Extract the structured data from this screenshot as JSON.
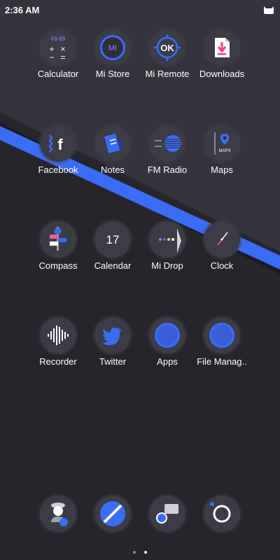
{
  "status_bar": {
    "time": "2:36 AM",
    "right_icon": "cat-icon"
  },
  "colors": {
    "accent": "#3b6cf6",
    "background_dark": "#25252b",
    "background_light": "#33333b",
    "icon_bg": "#3b3c46"
  },
  "apps": [
    {
      "label": "Calculator",
      "icon": "calculator-icon",
      "display": "69-69"
    },
    {
      "label": "Mi Store",
      "icon": "mi-store-icon",
      "badge": "MI"
    },
    {
      "label": "Mi Remote",
      "icon": "mi-remote-icon",
      "badge": "OK"
    },
    {
      "label": "Downloads",
      "icon": "downloads-icon"
    },
    {
      "label": "Facebook",
      "icon": "facebook-icon",
      "badge": "f"
    },
    {
      "label": "Notes",
      "icon": "notes-icon"
    },
    {
      "label": "FM Radio",
      "icon": "radio-icon"
    },
    {
      "label": "Maps",
      "icon": "maps-icon",
      "badge": "MAPS"
    },
    {
      "label": "Compass",
      "icon": "compass-icon"
    },
    {
      "label": "Calendar",
      "icon": "calendar-icon",
      "badge": "17"
    },
    {
      "label": "Mi Drop",
      "icon": "mi-drop-icon"
    },
    {
      "label": "Clock",
      "icon": "clock-icon"
    },
    {
      "label": "Recorder",
      "icon": "recorder-icon"
    },
    {
      "label": "Twitter",
      "icon": "twitter-icon"
    },
    {
      "label": "Apps",
      "icon": "apps-icon"
    },
    {
      "label": "File Manag..",
      "icon": "file-manager-icon"
    }
  ],
  "dock": [
    {
      "icon": "phone-icon"
    },
    {
      "icon": "browser-icon"
    },
    {
      "icon": "messages-icon"
    },
    {
      "icon": "camera-icon"
    }
  ],
  "page_indicator": {
    "pages": 2,
    "active": 2
  }
}
